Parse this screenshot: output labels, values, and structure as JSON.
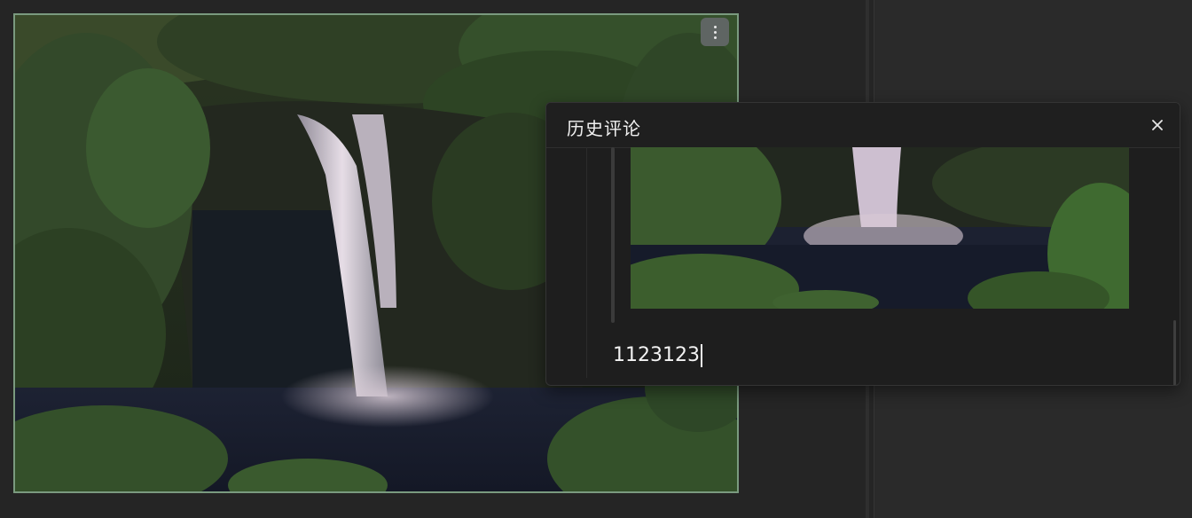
{
  "dialog": {
    "title": "历史评论",
    "comment_text": "1123123"
  },
  "icons": {
    "more": "more-vertical-icon",
    "close": "close-icon"
  },
  "colors": {
    "image_border": "#7a9a7f",
    "background": "#252525",
    "dialog_background": "#1e1e1e"
  }
}
